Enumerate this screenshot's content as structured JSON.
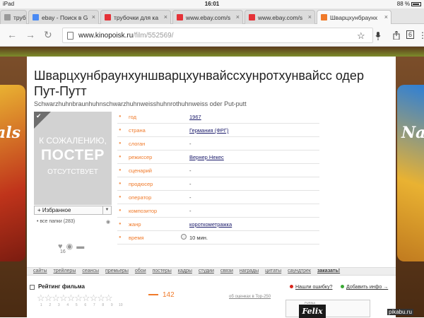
{
  "status": {
    "device": "iPad",
    "wifi": "wifi",
    "time": "16:01",
    "battery": "88 %",
    "battery_level": 0.88
  },
  "tabs": [
    {
      "label": "труб",
      "favicon_color": "#9a9a9a",
      "active": false
    },
    {
      "label": "ebay - Поиск в G",
      "favicon_color": "#4a8af4",
      "active": false
    },
    {
      "label": "трубочки для ка",
      "favicon_color": "#e53238",
      "active": false
    },
    {
      "label": "www.ebay.com/s",
      "favicon_color": "#e53238",
      "active": false
    },
    {
      "label": "www.ebay.com/s",
      "favicon_color": "#e53238",
      "active": false
    },
    {
      "label": "Шварцхунбраунх",
      "favicon_color": "#f07a2a",
      "active": true
    }
  ],
  "toolbar": {
    "back": "←",
    "forward": "→",
    "reload": "↻",
    "url_host": "www.kinopoisk.ru",
    "url_path": "/film/552569/",
    "star": "☆",
    "mic": "mic-icon",
    "share": "share-icon",
    "tabs_count": "6",
    "menu": "⋮"
  },
  "ads": {
    "left_text": "als",
    "right_text": "Na"
  },
  "film": {
    "title": "Шварцхунбраунхуншварцхунвайссхунротхунвайсс одер Пут-Путт",
    "original_title": "Schwarzhuhnbraunhuhnschwarzhuhnweisshuhnrothuhnweiss oder Put-putt",
    "poster": {
      "line1": "К СОЖАЛЕНИЮ,",
      "line2": "ПОСТЕР",
      "line3": "ОТСУТСТВУЕТ"
    },
    "favorites_label": "+ Избранное",
    "folders": "• все папки (283)",
    "likes": "16"
  },
  "info_rows": [
    {
      "key": "год",
      "value": "1967",
      "link": true
    },
    {
      "key": "страна",
      "value": "Германия (ФРГ)",
      "link": true
    },
    {
      "key": "слоган",
      "value": "-",
      "link": false
    },
    {
      "key": "режиссер",
      "value": "Вернер Некес",
      "link": true
    },
    {
      "key": "сценарий",
      "value": "-",
      "link": false
    },
    {
      "key": "продюсер",
      "value": "-",
      "link": false
    },
    {
      "key": "оператор",
      "value": "-",
      "link": false
    },
    {
      "key": "композитор",
      "value": "-",
      "link": false
    },
    {
      "key": "жанр",
      "value": "короткометражка",
      "link": true
    },
    {
      "key": "время",
      "value": "10 мин.",
      "link": false
    }
  ],
  "menu": [
    "сайты",
    "трейлеры",
    "сеансы",
    "премьеры",
    "обои",
    "постеры",
    "кадры",
    "студии",
    "связи",
    "награды",
    "цитаты",
    "саундтрек",
    "заказать!"
  ],
  "rating": {
    "label": "Рейтинг фильма",
    "stars": "☆☆☆☆☆☆☆☆☆☆",
    "numbers": [
      "1",
      "2",
      "3",
      "4",
      "5",
      "6",
      "7",
      "8",
      "9",
      "10"
    ],
    "votes": "142",
    "ratings_link": "об оценках в Top-250",
    "error_link": "Нашли ошибку?",
    "add_link": "Добавить инфо →",
    "ad_brand": "Felix",
    "ad_maker": "PURINA"
  },
  "watermark": "pikabu.ru",
  "colors": {
    "accent": "#f07a2a",
    "link": "#1a1a6a",
    "error_dot": "#d9261c",
    "add_dot": "#3aa935"
  }
}
